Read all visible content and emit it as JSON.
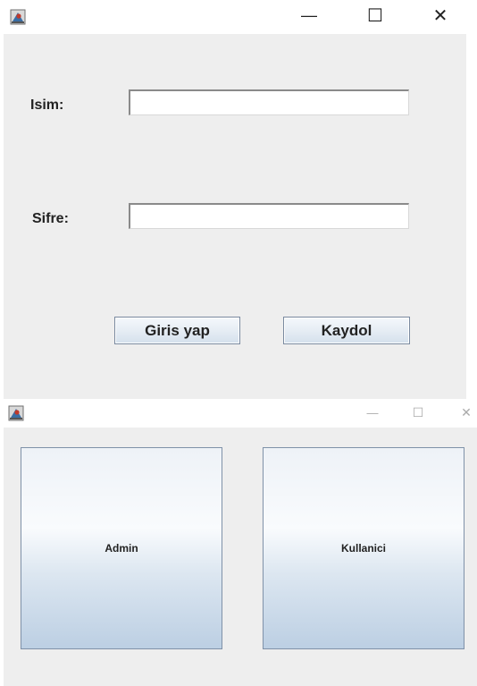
{
  "login_window": {
    "controls": {
      "minimize": "—",
      "maximize": "☐",
      "close": "✕"
    },
    "name_label": "Isim:",
    "name_value": "",
    "password_label": "Sifre:",
    "password_value": "",
    "login_button": "Giris yap",
    "register_button": "Kaydol"
  },
  "role_window": {
    "controls": {
      "minimize": "—",
      "maximize": "☐",
      "close": "✕"
    },
    "admin_button": "Admin",
    "user_button": "Kullanici"
  }
}
